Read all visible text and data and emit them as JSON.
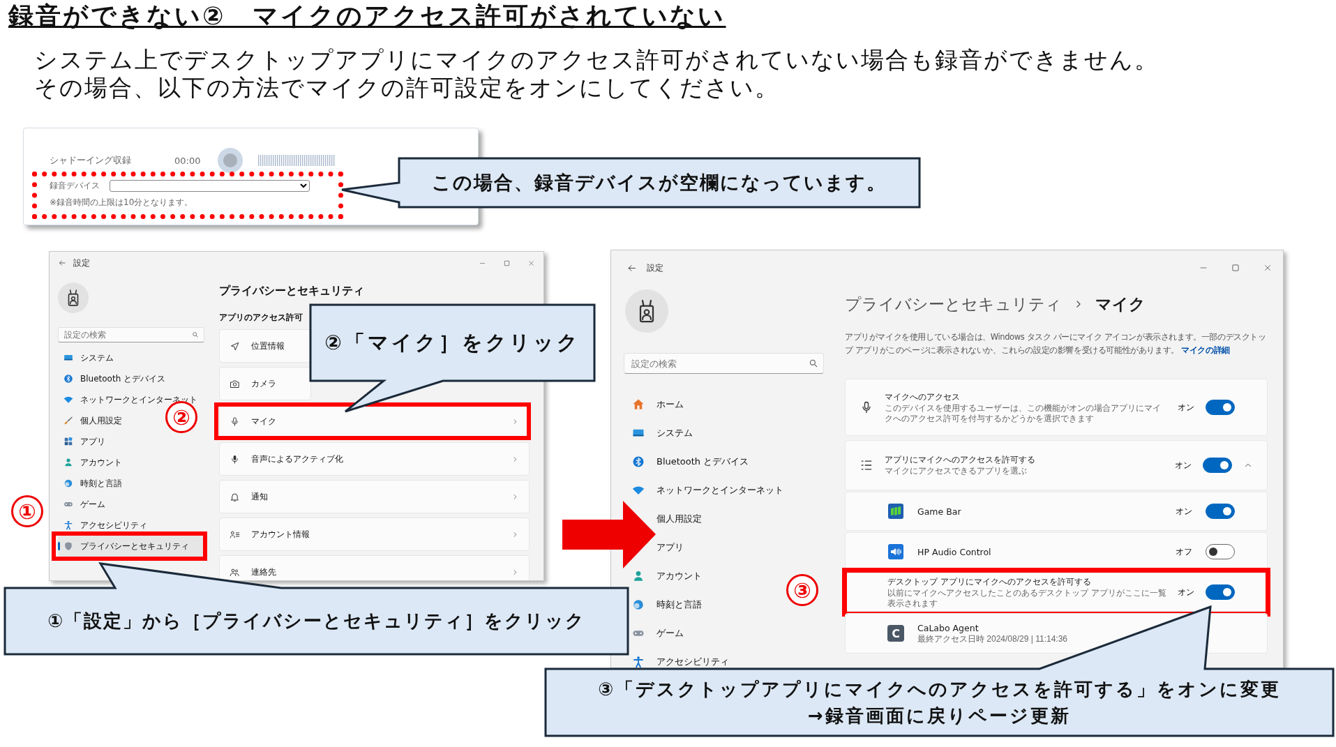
{
  "title": "録音ができない②　マイクのアクセス許可がされていない",
  "intro": [
    "システム上でデスクトップアプリにマイクのアクセス許可がされていない場合も録音ができません。",
    "その場合、以下の方法でマイクの許可設定をオンにしてください。"
  ],
  "recorder": {
    "label": "シャドーイング収録",
    "time": "00:00",
    "device_label": "録音デバイス",
    "note": "※録音時間の上限は10分となります。",
    "highlighted": true
  },
  "settings_left": {
    "title": "設定",
    "search": {
      "placeholder": "設定の検索"
    },
    "nav": [
      {
        "label": "システム",
        "selected": false,
        "highlighted": false
      },
      {
        "label": "Bluetooth とデバイス",
        "selected": false,
        "highlighted": false
      },
      {
        "label": "ネットワークとインターネット",
        "selected": false,
        "highlighted": false
      },
      {
        "label": "個人用設定",
        "selected": false,
        "highlighted": false
      },
      {
        "label": "アプリ",
        "selected": false,
        "highlighted": false
      },
      {
        "label": "アカウント",
        "selected": false,
        "highlighted": false
      },
      {
        "label": "時刻と言語",
        "selected": false,
        "highlighted": false
      },
      {
        "label": "ゲーム",
        "selected": false,
        "highlighted": false
      },
      {
        "label": "アクセシビリティ",
        "selected": false,
        "highlighted": false
      },
      {
        "label": "プライバシーとセキュリティ",
        "selected": true,
        "highlighted": true
      }
    ],
    "heading": "プライバシーとセキュリティ",
    "section": "アプリのアクセス許可",
    "rows": [
      {
        "label": "位置情報",
        "highlighted": false
      },
      {
        "label": "カメラ",
        "highlighted": false
      },
      {
        "label": "マイク",
        "highlighted": true
      },
      {
        "label": "音声によるアクティブ化",
        "highlighted": false
      },
      {
        "label": "通知",
        "highlighted": false
      },
      {
        "label": "アカウント情報",
        "highlighted": false
      },
      {
        "label": "連絡先",
        "highlighted": false
      }
    ]
  },
  "settings_right": {
    "title": "設定",
    "search": {
      "placeholder": "設定の検索"
    },
    "nav": [
      "ホーム",
      "システム",
      "Bluetooth とデバイス",
      "ネットワークとインターネット",
      "個人用設定",
      "アプリ",
      "アカウント",
      "時刻と言語",
      "ゲーム",
      "アクセシビリティ"
    ],
    "breadcrumb": [
      "プライバシーとセキュリティ",
      "マイク"
    ],
    "description": "アプリがマイクを使用している場合は、Windows タスク バーにマイク アイコンが表示されます。一部のデスクトップ アプリがこのページに表示されないか、これらの設定の影響を受ける可能性があります。",
    "description_link": "マイクの詳細",
    "cards": [
      {
        "kind": "setting",
        "title": "マイクへのアクセス",
        "description": "このデバイスを使用するユーザーは、この機能がオンの場合アプリにマイクへのアクセス許可を付与するかどうかを選択できます",
        "state": "オン",
        "on": true,
        "highlighted": false
      },
      {
        "kind": "group",
        "title": "アプリにマイクへのアクセスを許可する",
        "description": "マイクにアクセスできるアプリを選ぶ",
        "state": "オン",
        "on": true,
        "expanded": true,
        "highlighted": false
      },
      {
        "kind": "app",
        "title": "Game Bar",
        "state": "オン",
        "on": true,
        "highlighted": false
      },
      {
        "kind": "app",
        "title": "HP Audio Control",
        "state": "オフ",
        "on": false,
        "highlighted": false
      },
      {
        "kind": "subsetting",
        "title": "デスクトップ アプリにマイクへのアクセスを許可する",
        "description": "以前にマイクへアクセスしたことのあるデスクトップ アプリがここに一覧表示されます",
        "state": "オン",
        "on": true,
        "highlighted": true
      },
      {
        "kind": "history",
        "icon_letter": "C",
        "title": "CaLabo Agent",
        "description": "最終アクセス日時 2024/08/29 | 11:14:36",
        "highlighted": false
      }
    ]
  },
  "step_markers": [
    "①",
    "②",
    "③"
  ],
  "callouts": [
    {
      "lines": [
        "この場合、録音デバイスが空欄になっています。"
      ]
    },
    {
      "lines": [
        "②「マイク］をクリック"
      ]
    },
    {
      "lines": [
        "①「設定」から［プライバシーとセキュリティ］をクリック"
      ]
    },
    {
      "lines": [
        "③「デスクトップアプリにマイクへのアクセスを許可する」をオンに変更",
        "→録音画面に戻りページ更新"
      ]
    }
  ]
}
